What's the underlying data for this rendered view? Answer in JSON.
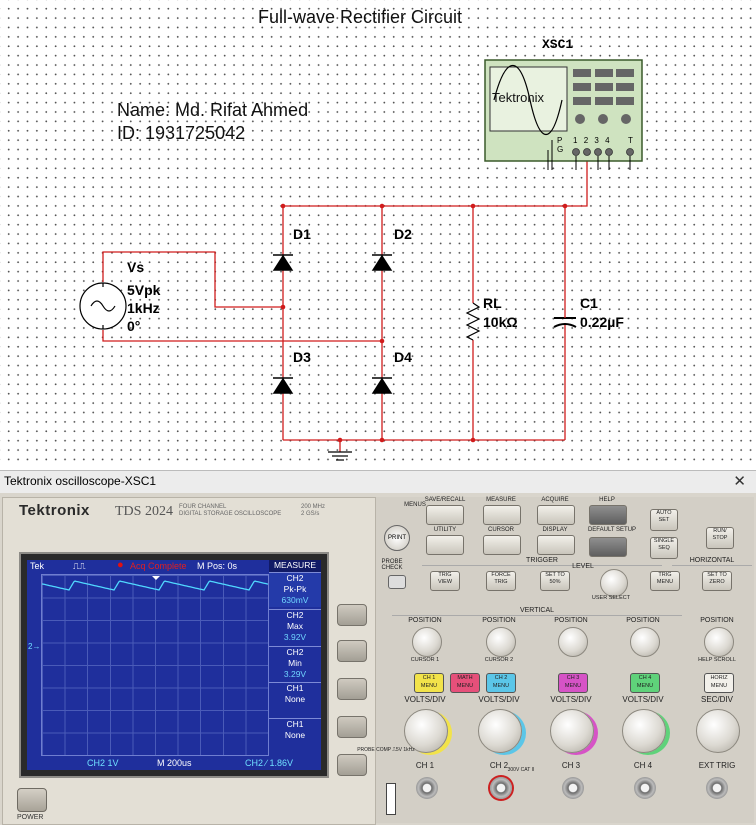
{
  "schematic": {
    "title": "Full-wave Rectifier Circuit",
    "name_line": "Name: Md. Rifat Ahmed",
    "id_line": "ID: 1931725042",
    "source": {
      "name": "Vs",
      "amplitude": "5Vpk",
      "frequency": "1kHz",
      "phase": "0°"
    },
    "diodes": [
      "D1",
      "D2",
      "D3",
      "D4"
    ],
    "resistor": {
      "name": "RL",
      "value": "10kΩ"
    },
    "capacitor": {
      "name": "C1",
      "value": "0.22µF"
    },
    "scope_ref": "XSC1",
    "scope_icon_brand": "Tektronix",
    "scope_pins": [
      "P",
      "G",
      "1",
      "2",
      "3",
      "4",
      "T"
    ]
  },
  "window": {
    "title": "Tektronix oscilloscope-XSC1",
    "close": "✕"
  },
  "scope": {
    "brand": "Tektronix",
    "model": "TDS 2024",
    "model_sub_1": "FOUR CHANNEL",
    "model_sub_2": "DIGITAL STORAGE OSCILLOSCOPE",
    "spec_1": "200 MHz",
    "spec_2": "2 GS/s",
    "screen": {
      "tek": "Tek",
      "acq": "Acq Complete",
      "mpos": "M Pos: 0s",
      "measure": "MEASURE",
      "ch_marker": "2",
      "measures": [
        {
          "ch": "CH2",
          "type": "Pk-Pk",
          "value": "630mV"
        },
        {
          "ch": "CH2",
          "type": "Max",
          "value": "3.92V"
        },
        {
          "ch": "CH2",
          "type": "Min",
          "value": "3.29V"
        },
        {
          "ch": "CH1",
          "type": "None",
          "value": ""
        },
        {
          "ch": "CH1",
          "type": "None",
          "value": ""
        }
      ],
      "ch2_scale": "CH2  1V",
      "timebase": "M 200us",
      "trigger": "CH2 ∕ 1.86V"
    },
    "power_label": "POWER",
    "buttons": {
      "print": "PRINT",
      "probe_check": "PROBE CHECK",
      "menus": "MENUS",
      "save_recall": "SAVE/RECALL",
      "measure": "MEASURE",
      "acquire": "ACQUIRE",
      "help": "HELP",
      "utility": "UTILITY",
      "cursor": "CURSOR",
      "display": "DISPLAY",
      "default_setup": "DEFAULT SETUP",
      "autoset": "AUTO SET",
      "single_seq": "SINGLE SEQ",
      "run_stop": "RUN/ STOP",
      "trig_view": "TRIG VIEW",
      "force_trig": "FORCE TRIG",
      "set_to_50": "SET TO 50%",
      "trig_menu": "TRIG MENU",
      "set_to_zero": "SET TO ZERO",
      "ch1_menu": "CH 1 MENU",
      "math_menu": "MATH MENU",
      "ch2_menu": "CH 2 MENU",
      "ch3_menu": "CH 3 MENU",
      "ch4_menu": "CH 4 MENU",
      "horiz_menu": "HORIZ MENU"
    },
    "sections": {
      "trigger": "TRIGGER",
      "horizontal": "HORIZONTAL",
      "vertical": "VERTICAL"
    },
    "labels": {
      "level": "LEVEL",
      "user_select": "USER SELECT",
      "position": "POSITION",
      "cursor1": "CURSOR 1",
      "cursor2": "CURSOR 2",
      "help_scroll": "HELP SCROLL",
      "volts_div": "VOLTS/DIV",
      "sec_div": "SEC/DIV",
      "ch1": "CH 1",
      "ch2": "CH 2",
      "ch3": "CH 3",
      "ch4": "CH 4",
      "ext_trig": "EXT TRIG",
      "probe_comp": "PROBE COMP ⎍5V 1kHz",
      "cat": "300V CAT II"
    },
    "colors": {
      "ch1": "#f2e34a",
      "math": "#e6507a",
      "ch2": "#5bc6e8",
      "ch3": "#d653c6",
      "ch4": "#5fd27a",
      "trace": "#50d8ff"
    }
  }
}
